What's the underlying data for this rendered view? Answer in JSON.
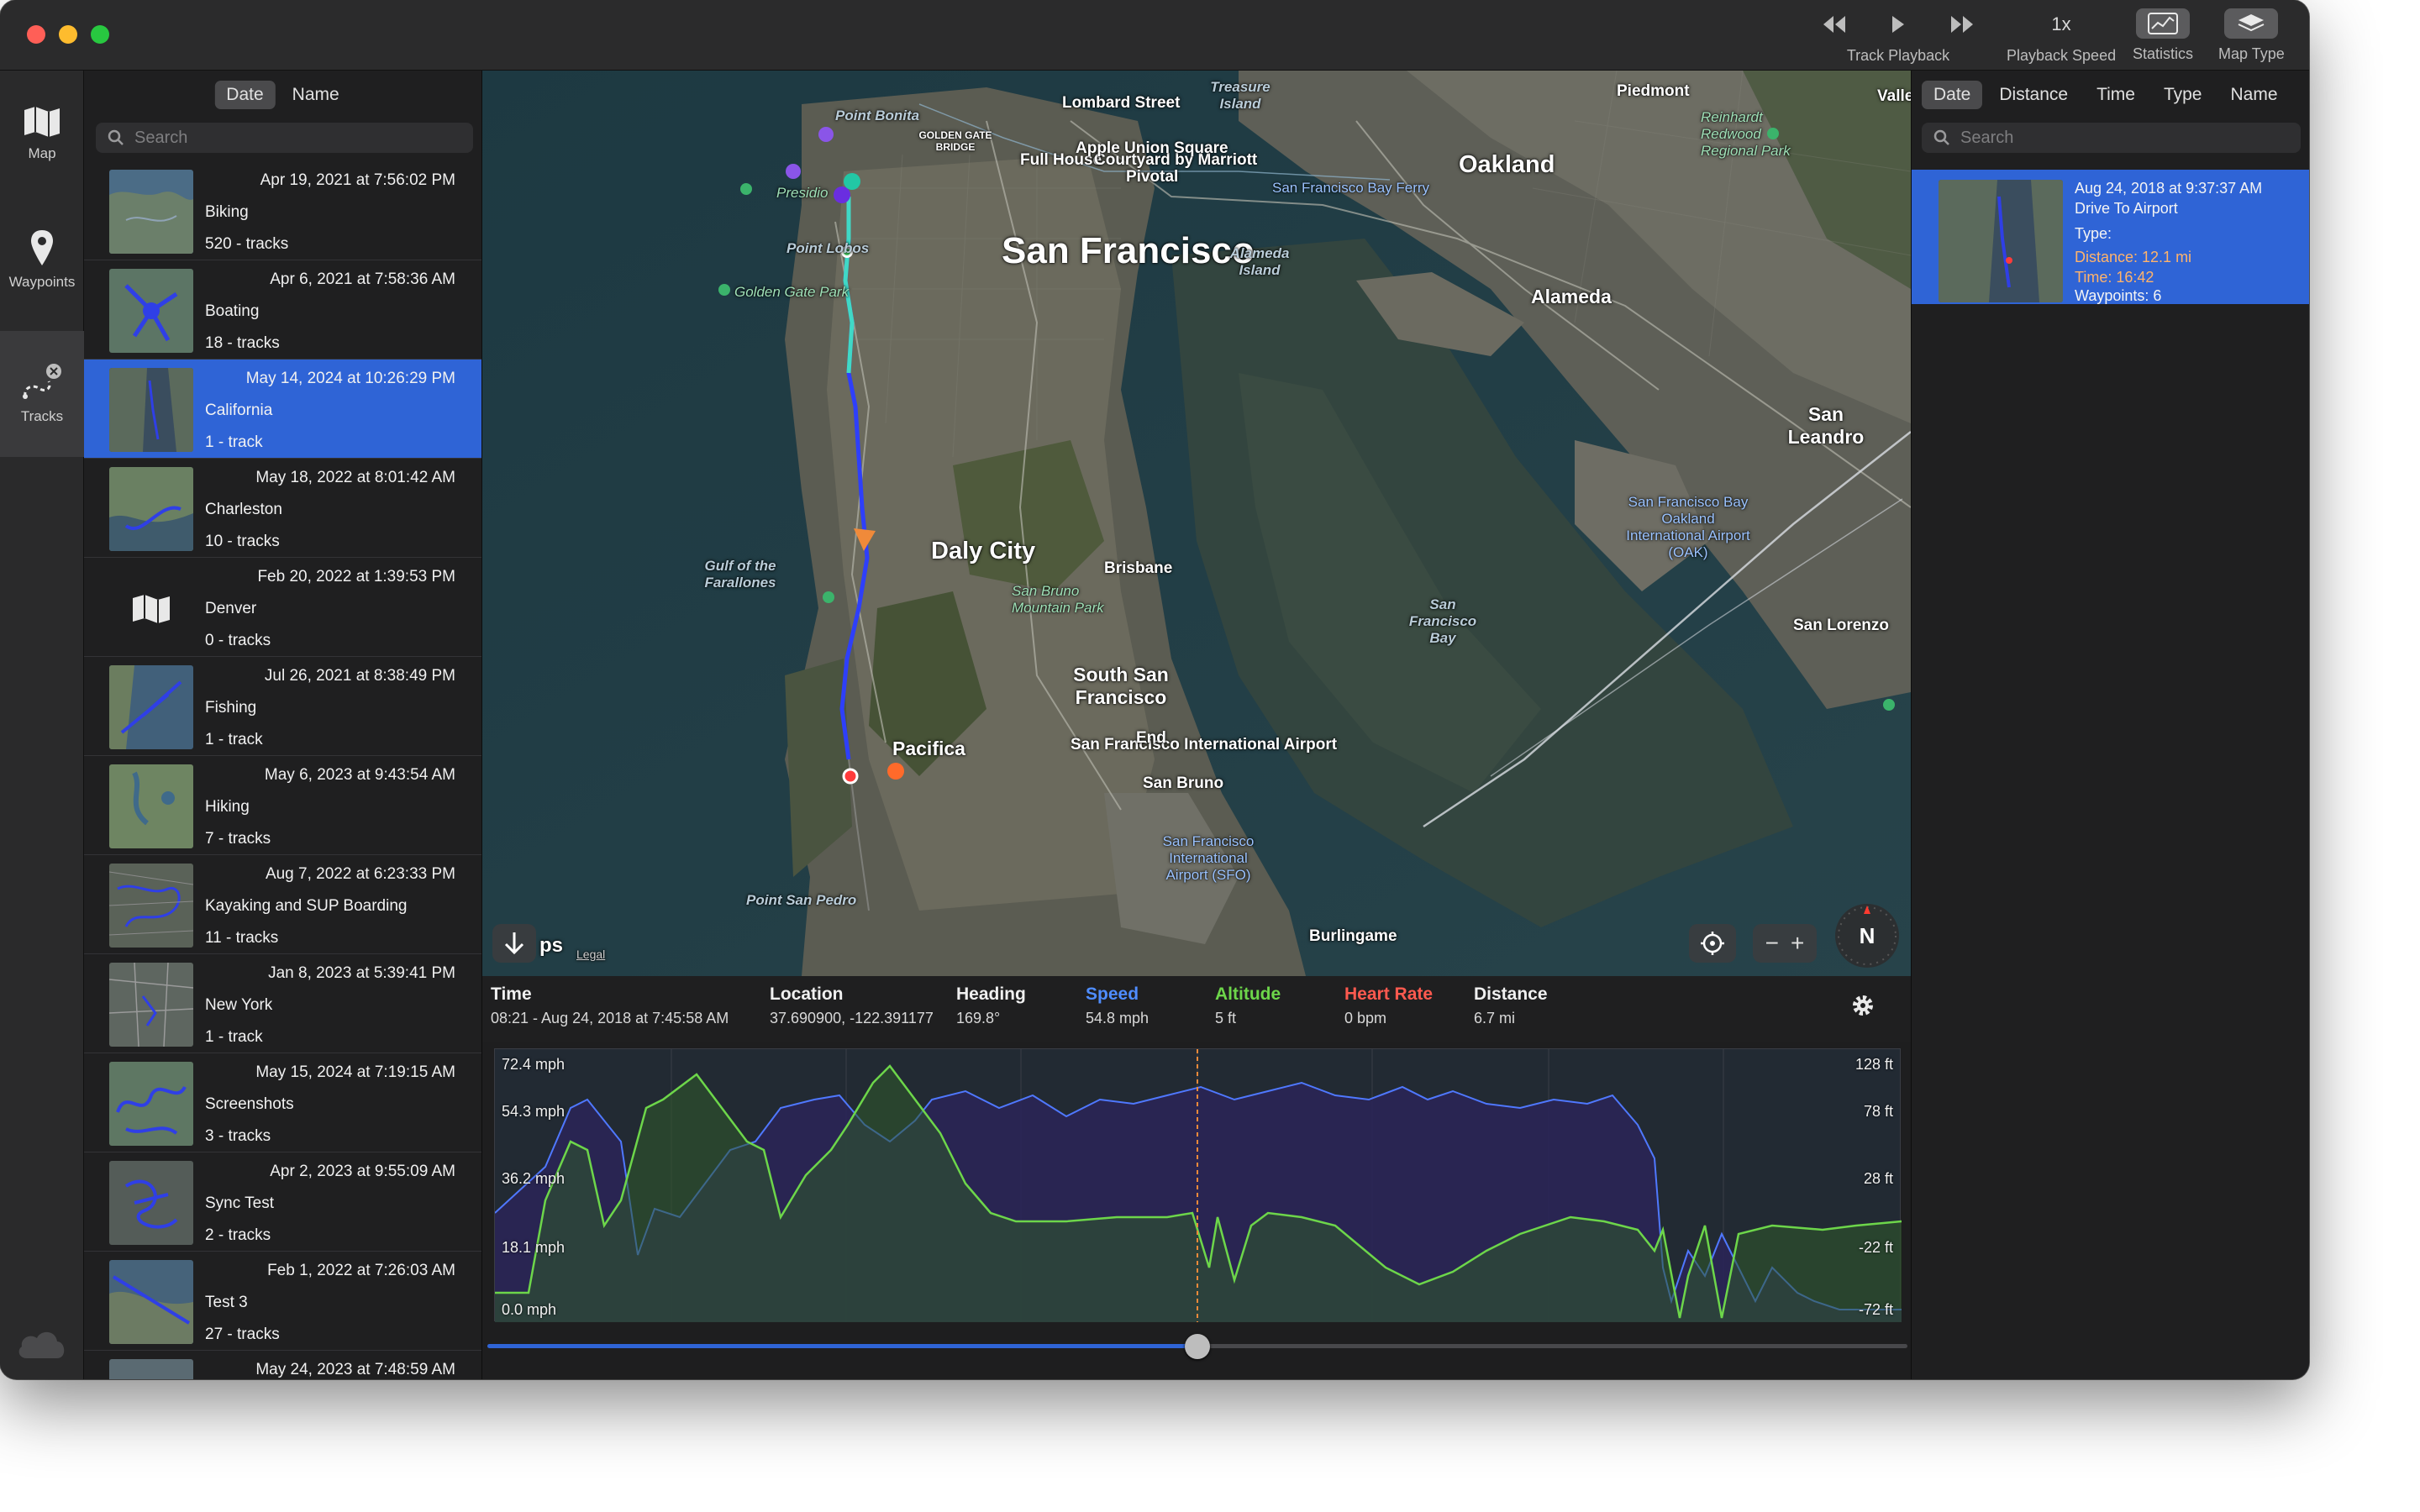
{
  "toolbar": {
    "track_playback_label": "Track Playback",
    "playback_speed_value": "1x",
    "playback_speed_label": "Playback Speed",
    "statistics_label": "Statistics",
    "map_type_label": "Map Type"
  },
  "rail": {
    "map_label": "Map",
    "waypoints_label": "Waypoints",
    "tracks_label": "Tracks"
  },
  "list": {
    "sort_date": "Date",
    "sort_name": "Name",
    "search_placeholder": "Search",
    "items": [
      {
        "date": "Apr 19, 2021 at 7:56:02 PM",
        "name": "Biking",
        "count": "520 - tracks"
      },
      {
        "date": "Apr 6, 2021 at 7:58:36 AM",
        "name": "Boating",
        "count": "18 - tracks"
      },
      {
        "date": "May 14, 2024 at 10:26:29 PM",
        "name": "California",
        "count": "1 - track"
      },
      {
        "date": "May 18, 2022 at 8:01:42 AM",
        "name": "Charleston",
        "count": "10 - tracks"
      },
      {
        "date": "Feb 20, 2022 at 1:39:53 PM",
        "name": "Denver",
        "count": "0 - tracks"
      },
      {
        "date": "Jul 26, 2021 at 8:38:49 PM",
        "name": "Fishing",
        "count": "1 - track"
      },
      {
        "date": "May 6, 2023 at 9:43:54 AM",
        "name": "Hiking",
        "count": "7 - tracks"
      },
      {
        "date": "Aug 7, 2022 at 6:23:33 PM",
        "name": "Kayaking and SUP Boarding",
        "count": "11 - tracks"
      },
      {
        "date": "Jan 8, 2023 at 5:39:41 PM",
        "name": "New York",
        "count": "1 - track"
      },
      {
        "date": "May 15, 2024 at 7:19:15 AM",
        "name": "Screenshots",
        "count": "3 - tracks"
      },
      {
        "date": "Apr 2, 2023 at 9:55:09 AM",
        "name": "Sync Test",
        "count": "2 - tracks"
      },
      {
        "date": "Feb 1, 2022 at 7:26:03 AM",
        "name": "Test 3",
        "count": "27 - tracks"
      },
      {
        "date": "May 24, 2023 at 7:48:59 AM",
        "name": "",
        "count": ""
      }
    ]
  },
  "map": {
    "labels": {
      "san_francisco": "San Francisco",
      "oakland": "Oakland",
      "alameda": "Alameda",
      "daly_city": "Daly City",
      "south_sf": "South San Francisco",
      "pacifica": "Pacifica",
      "san_leandro": "San Leandro",
      "lombard": "Lombard Street",
      "full_house": "Full House",
      "courtyard": "Courtyard by Marriott",
      "apple_union": "Apple Union Square",
      "pivotal": "Pivotal",
      "brisbane": "Brisbane",
      "sfo": "San Francisco International Airport",
      "burlingame": "Burlingame",
      "piedmont": "Piedmont",
      "vallejo": "Valle",
      "san_lorenzo": "San Lorenzo",
      "end": "End",
      "san_bruno": "San Bruno",
      "point_bonita": "Point Bonita",
      "point_lobos": "Point Lobos",
      "point_san_pedro": "Point San Pedro",
      "presidio": "Presidio",
      "golden_gate_park": "Golden Gate Park",
      "golden_gate_bridge": "GOLDEN GATE BRIDGE",
      "treasure_island": "Treasure Island",
      "alameda_island": "Alameda Island",
      "gulf": "Gulf of the Farallones",
      "sf_bay": "San Francisco Bay",
      "san_bruno_mtn": "San Bruno Mountain Park",
      "oak_airport": "San Francisco Bay Oakland International Airport (OAK)",
      "sfo_airport": "San Francisco International Airport (SFO)",
      "reinhardt": "Reinhardt Redwood Regional Park",
      "ferry": "San Francisco Bay Ferry",
      "maps_suffix": "ps",
      "legal": "Legal",
      "compass": "N"
    }
  },
  "info": {
    "time_h": "Time",
    "time_v": "08:21 - Aug 24, 2018 at 7:45:58 AM",
    "location_h": "Location",
    "location_v": "37.690900, -122.391177",
    "heading_h": "Heading",
    "heading_v": "169.8°",
    "speed_h": "Speed",
    "speed_v": "54.8 mph",
    "altitude_h": "Altitude",
    "altitude_v": "5 ft",
    "hr_h": "Heart Rate",
    "hr_v": "0 bpm",
    "distance_h": "Distance",
    "distance_v": "6.7 mi"
  },
  "graph": {
    "left_labels": [
      "72.4 mph",
      "54.3 mph",
      "36.2 mph",
      "18.1 mph",
      "0.0 mph"
    ],
    "right_labels": [
      "128 ft",
      "78 ft",
      "28 ft",
      "-22 ft",
      "-72 ft"
    ],
    "playhead_fraction": 0.5,
    "colors": {
      "speed": "#4f78ff",
      "altitude": "#6dd64a",
      "heart_rate": "#ff5a4f"
    }
  },
  "right": {
    "sort_date": "Date",
    "sort_distance": "Distance",
    "sort_time": "Time",
    "sort_type": "Type",
    "sort_name": "Name",
    "search_placeholder": "Search",
    "card": {
      "date": "Aug 24, 2018 at 9:37:37 AM",
      "name": "Drive To Airport",
      "type": "Type:",
      "distance": "Distance: 12.1 mi",
      "time": "Time: 16:42",
      "waypoints": "Waypoints: 6"
    }
  },
  "colors": {
    "accent": "#2f64d6",
    "speed": "#4f78ff",
    "altitude": "#6dd64a",
    "heart_rate": "#ff5a4f"
  }
}
